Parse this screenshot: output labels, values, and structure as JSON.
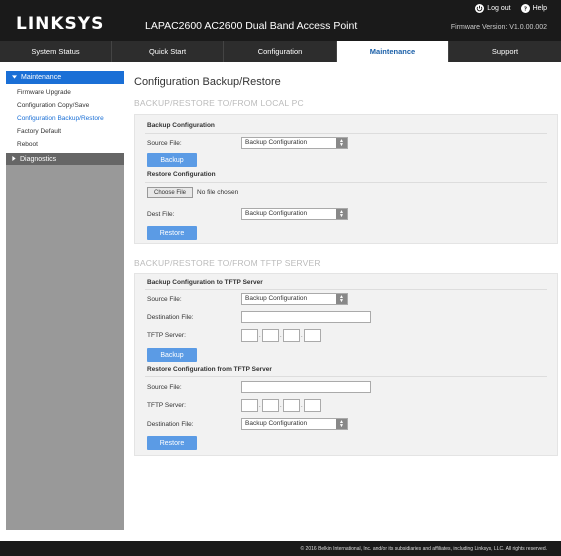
{
  "header": {
    "logo": "LINKSYS",
    "device_title": "LAPAC2600 AC2600 Dual Band Access Point",
    "logout_label": "Log out",
    "help_label": "Help",
    "firmware": "Firmware Version: V1.0.00.002"
  },
  "nav": {
    "tabs": [
      {
        "label": "System Status"
      },
      {
        "label": "Quick Start"
      },
      {
        "label": "Configuration"
      },
      {
        "label": "Maintenance"
      },
      {
        "label": "Support"
      }
    ]
  },
  "sidebar": {
    "maintenance_label": "Maintenance",
    "items": [
      {
        "label": "Firmware Upgrade"
      },
      {
        "label": "Configuration Copy/Save"
      },
      {
        "label": "Configuration Backup/Restore"
      },
      {
        "label": "Factory Default"
      },
      {
        "label": "Reboot"
      }
    ],
    "diagnostics_label": "Diagnostics"
  },
  "main": {
    "page_title": "Configuration Backup/Restore",
    "local": {
      "section_title": "BACKUP/RESTORE TO/FROM LOCAL PC",
      "backup_head": "Backup Configuration",
      "source_file_label": "Source File:",
      "source_file_value": "Backup Configuration",
      "backup_button": "Backup",
      "restore_head": "Restore Configuration",
      "choose_file_button": "Choose File",
      "no_file_text": "No file chosen",
      "dest_file_label": "Dest File:",
      "dest_file_value": "Backup Configuration",
      "restore_button": "Restore"
    },
    "tftp": {
      "section_title": "BACKUP/RESTORE TO/FROM TFTP SERVER",
      "backup_head": "Backup Configuration to TFTP Server",
      "source_file_label": "Source File:",
      "source_file_value": "Backup Configuration",
      "destination_file_label": "Destination File:",
      "tftp_server_label": "TFTP Server:",
      "backup_button": "Backup",
      "restore_head": "Restore Configuration from TFTP Server",
      "restore_source_label": "Source File:",
      "restore_tftp_label": "TFTP Server:",
      "restore_dest_label": "Destination File:",
      "restore_dest_value": "Backup Configuration",
      "restore_button": "Restore"
    }
  },
  "footer": {
    "copyright": "© 2016 Belkin International, Inc. and/or its subsidiaries and affiliates, including Linksys, LLC. All rights reserved."
  },
  "colors": {
    "header_bg": "#1a1a1a",
    "nav_bg": "#2d2d2d",
    "accent_blue": "#1a6fd6",
    "button_blue": "#5b9be5",
    "sidebar_gray": "#999999",
    "panel_bg": "#f2f2f2"
  },
  "icons": [
    "log-out-icon",
    "help-icon",
    "expand-arrow-icon",
    "collapse-arrow-icon",
    "select-arrow-icon"
  ]
}
